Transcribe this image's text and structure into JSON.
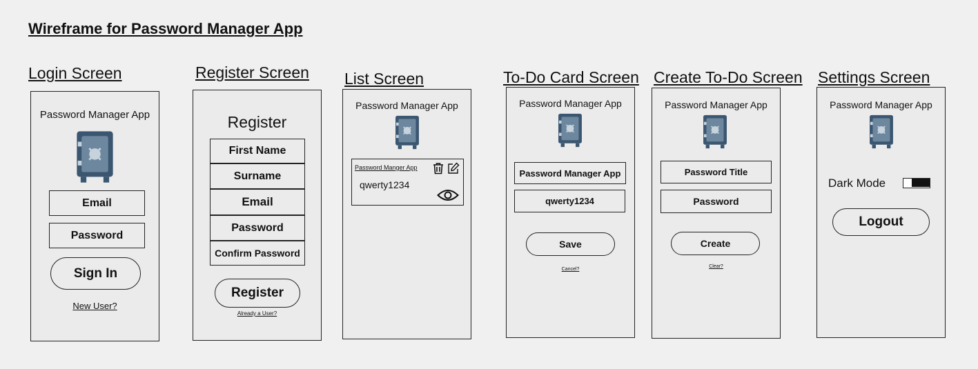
{
  "title": "Wireframe for Password Manager App",
  "login": {
    "heading": "Login Screen",
    "app_name": "Password Manager App",
    "email": "Email",
    "password": "Password",
    "sign_in": "Sign In",
    "new_user": "New User?"
  },
  "register": {
    "heading": "Register Screen",
    "title": "Register",
    "first_name": "First Name",
    "surname": "Surname",
    "email": "Email",
    "password": "Password",
    "confirm_password": "Confirm Password",
    "register_button": "Register",
    "already_user": "Already a User?"
  },
  "list": {
    "heading": "List Screen",
    "app_name": "Password Manager App",
    "card_title": "Password Manger App",
    "card_password": "qwerty1234"
  },
  "todo_card": {
    "heading": "To-Do Card Screen",
    "app_name": "Password Manager App",
    "title_value": "Password Manager App",
    "password_value": "qwerty1234",
    "save": "Save",
    "cancel": "Cancel?"
  },
  "create_todo": {
    "heading": "Create To-Do Screen",
    "app_name": "Password Manager App",
    "title_field": "Password Title",
    "password_field": "Password",
    "create": "Create",
    "clear": "Clear?"
  },
  "settings": {
    "heading": "Settings Screen",
    "app_name": "Password Manager App",
    "dark_mode": "Dark Mode",
    "logout": "Logout"
  },
  "icons": {
    "safe": "safe-icon",
    "trash": "trash-icon",
    "edit": "edit-icon",
    "eye": "eye-icon"
  },
  "colors": {
    "safe_body": "#3b5670",
    "safe_door": "#6c879e",
    "safe_dial": "#c6d3dd"
  }
}
